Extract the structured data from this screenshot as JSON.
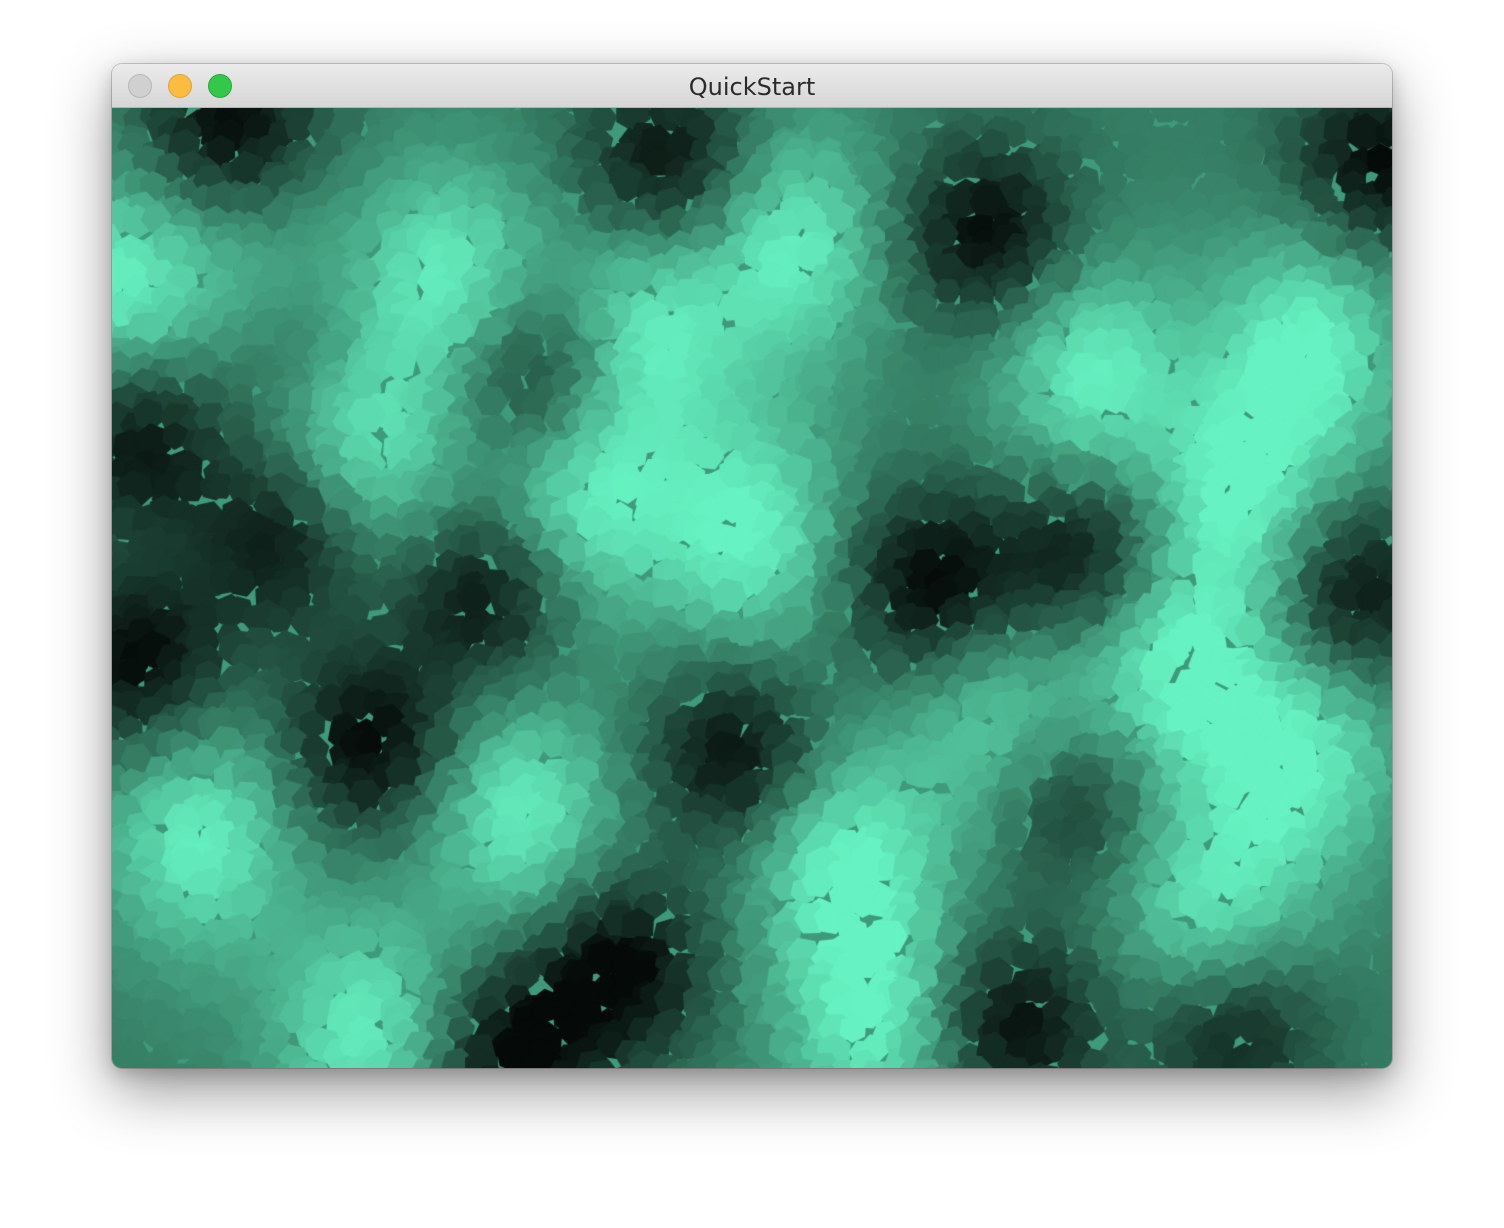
{
  "window": {
    "title": "QuickStart"
  },
  "colors": {
    "accent": "#66f2c2",
    "dark": "#050a08"
  },
  "content": {
    "description_icon": "noise-voronoi-canvas"
  }
}
